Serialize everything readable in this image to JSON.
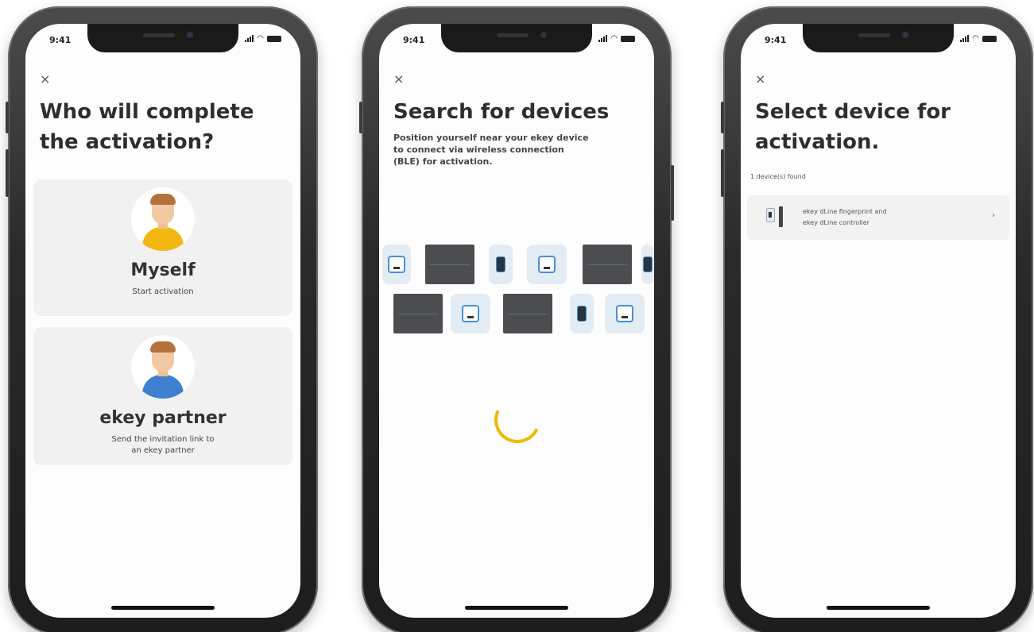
{
  "phones": [
    {
      "status_time": "9:41",
      "close_label": "×",
      "title_line1": "Who will complete",
      "title_line2": "the activation?",
      "options": [
        {
          "title": "Myself",
          "subtitle": "Start activation"
        },
        {
          "title": "ekey partner",
          "subtitle_line1": "Send the invitation link to",
          "subtitle_line2": "an ekey partner"
        }
      ]
    },
    {
      "status_time": "9:41",
      "close_label": "×",
      "title": "Search for devices",
      "description_line1": "Position yourself near your ekey device",
      "description_line2": "to connect via wireless connection",
      "description_line3": "(BLE) for activation."
    },
    {
      "status_time": "9:41",
      "close_label": "×",
      "title_line1": "Select device for",
      "title_line2": "activation.",
      "found_text": "1 device(s) found",
      "device": {
        "line1": "ekey dLine fingerprint and",
        "line2": "ekey dLine controller",
        "chevron": "›"
      }
    }
  ],
  "icons": {
    "close": "close-icon",
    "chevron": "chevron-right-icon",
    "spinner": "loading-spinner-icon"
  },
  "colors": {
    "accent_yellow": "#f2b705",
    "avatar_blue": "#3f7fd0",
    "avatar_yellow": "#f3b712",
    "card_bg": "#f1f1f2",
    "device_blue": "#4a8fd6"
  }
}
